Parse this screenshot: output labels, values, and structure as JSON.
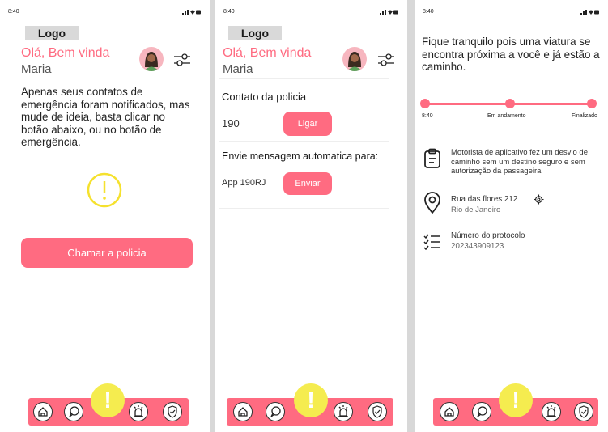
{
  "status": {
    "time": "8:40"
  },
  "header": {
    "logo": "Logo",
    "greeting": "Olá, Bem vinda",
    "name": "Maria"
  },
  "screen1": {
    "message": "Apenas seus contatos de emergência foram notificados, mas mude de ideia, basta clicar no botão abaixo, ou no botão de emergência.",
    "call_police_button": "Chamar a policia"
  },
  "screen2": {
    "contact_title": "Contato da policia",
    "phone": "190",
    "call_button": "Ligar",
    "auto_message_title": "Envie mensagem automatica para:",
    "app_name": "App 190RJ",
    "send_button": "Enviar"
  },
  "screen3": {
    "message": "Fique tranquilo pois uma viatura se encontra próxima a você e já estão a caminho.",
    "progress": {
      "start": "8:40",
      "middle": "Em andamento",
      "end": "Finalizado"
    },
    "report": "Motorista de aplicativo fez um desvio de caminho sem um destino seguro e sem autorização da passageira",
    "address": "Rua das flores 212",
    "city": "Rio de Janeiro",
    "protocol_label": "Número do protocolo",
    "protocol_number": "202343909123"
  },
  "navbar": {
    "alert_label": "!"
  },
  "colors": {
    "accent": "#ff6b81",
    "alert": "#f5ec4f"
  }
}
